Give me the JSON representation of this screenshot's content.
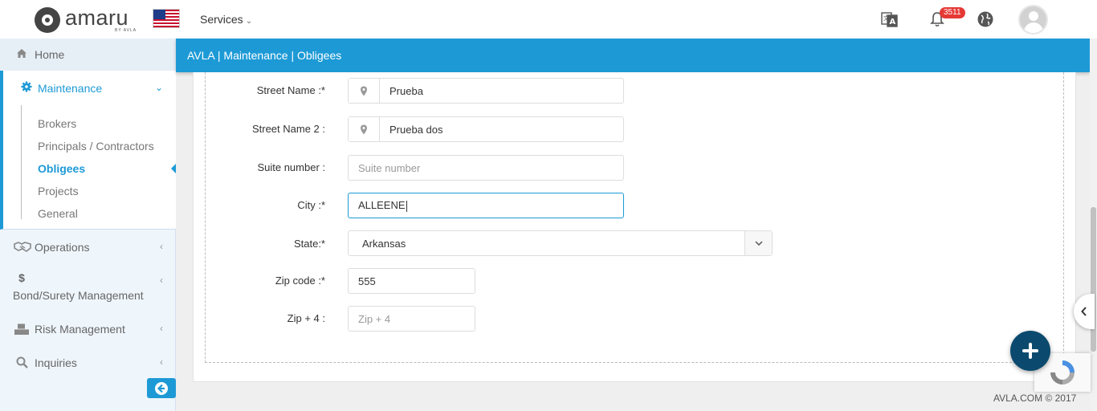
{
  "brand": {
    "name": "amaru",
    "sub": "BY AVLA"
  },
  "header": {
    "services_label": "Services",
    "notification_count": "3511"
  },
  "sidebar": {
    "home": "Home",
    "maintenance": "Maintenance",
    "sub_items": [
      "Brokers",
      "Principals / Contractors",
      "Obligees",
      "Projects",
      "General"
    ],
    "operations": "Operations",
    "bond": "Bond/Surety Management",
    "risk": "Risk Management",
    "inquiries": "Inquiries"
  },
  "breadcrumb": "AVLA | Maintenance | Obligees",
  "form": {
    "street_name": {
      "label": "Street Name :*",
      "value": "Prueba"
    },
    "street_name_2": {
      "label": "Street Name 2 :",
      "value": "Prueba dos"
    },
    "suite": {
      "label": "Suite number :",
      "placeholder": "Suite number"
    },
    "city": {
      "label": "City :*",
      "value": "ALLEENE"
    },
    "state": {
      "label": "State:*",
      "value": "Arkansas"
    },
    "zip": {
      "label": "Zip code :*",
      "value": "555"
    },
    "zip4": {
      "label": "Zip + 4 :",
      "placeholder": "Zip + 4"
    }
  },
  "footer": "AVLA.COM © 2017",
  "colors": {
    "accent": "#1d9ad6",
    "fab": "#0b4a6e",
    "badge": "#e53935"
  }
}
